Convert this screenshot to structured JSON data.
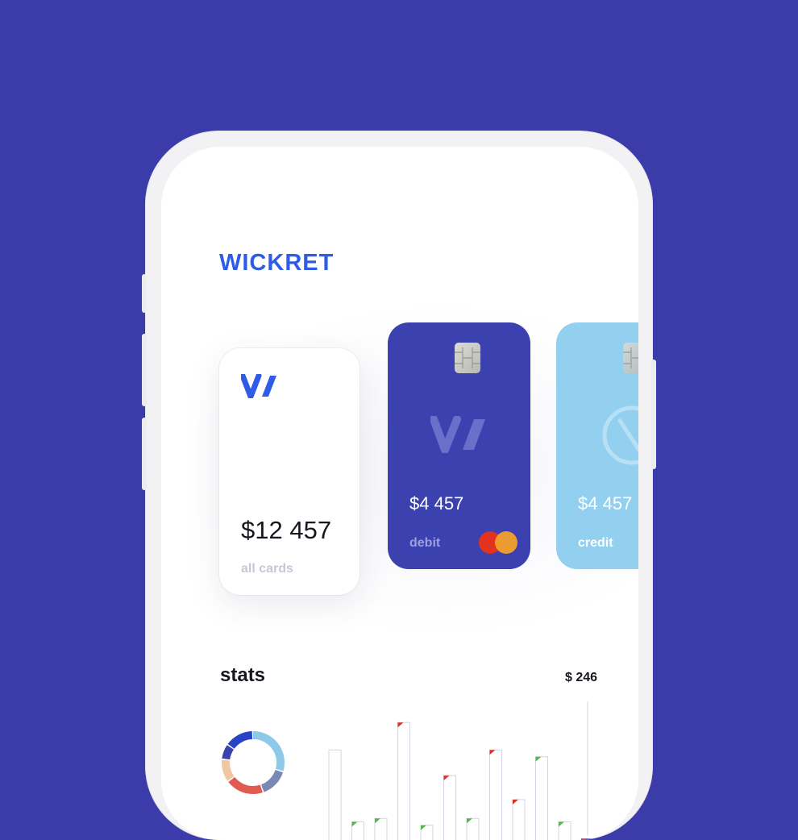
{
  "app": {
    "name": "WICKRET",
    "brand_color": "#2e5ce6",
    "background_color": "#3b3ca9"
  },
  "cards": [
    {
      "id": "all",
      "amount": "$12 457",
      "label": "all cards",
      "icon": "w-logo-icon"
    },
    {
      "id": "debit",
      "amount": "$4 457",
      "label": "debit",
      "network_icon": "mastercard-icon",
      "color": "#3b41ae"
    },
    {
      "id": "credit",
      "amount": "$4 457",
      "label": "credit",
      "color": "#93cfee"
    }
  ],
  "stats": {
    "title": "stats",
    "total": "$ 246",
    "chart_data": [
      {
        "type": "pie",
        "style": "donut",
        "values": [
          30,
          15,
          20,
          12,
          8,
          15
        ],
        "colors": [
          "#8ec9ea",
          "#7a88b4",
          "#e05a52",
          "#f0c7a0",
          "#3b41ae",
          "#2a43c4"
        ]
      },
      {
        "type": "bar",
        "values": [
          62,
          20,
          22,
          78,
          18,
          47,
          22,
          62,
          33,
          58,
          20,
          10
        ],
        "markers": [
          "none",
          "up",
          "up",
          "down",
          "up",
          "down",
          "up",
          "down",
          "down",
          "up",
          "up",
          "down"
        ],
        "highlighted_index": 11,
        "marker_colors": {
          "up": "#52b848",
          "down": "#d8332b"
        }
      }
    ]
  }
}
